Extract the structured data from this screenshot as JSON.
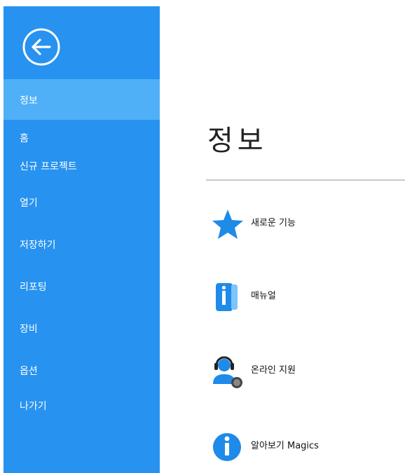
{
  "sidebar": {
    "items": [
      {
        "label": "정보",
        "active": true
      },
      {
        "label": "홈"
      },
      {
        "label": "신규 프로젝트"
      },
      {
        "label": "열기"
      },
      {
        "label": "저장하기"
      },
      {
        "label": "리포팅"
      },
      {
        "label": "장비"
      },
      {
        "label": "옵션"
      },
      {
        "label": "나가기"
      }
    ]
  },
  "main": {
    "title": "정보",
    "features": [
      {
        "label": "새로운 기능",
        "icon": "star-icon"
      },
      {
        "label": "매뉴얼",
        "icon": "manual-book-icon"
      },
      {
        "label": "온라인 지원",
        "icon": "support-headset-icon"
      },
      {
        "label": "알아보기 Magics",
        "icon": "info-icon"
      }
    ]
  },
  "colors": {
    "sidebar_bg": "#2792f0",
    "sidebar_active": "#4fb0f7",
    "icon_blue": "#1e8be8"
  }
}
